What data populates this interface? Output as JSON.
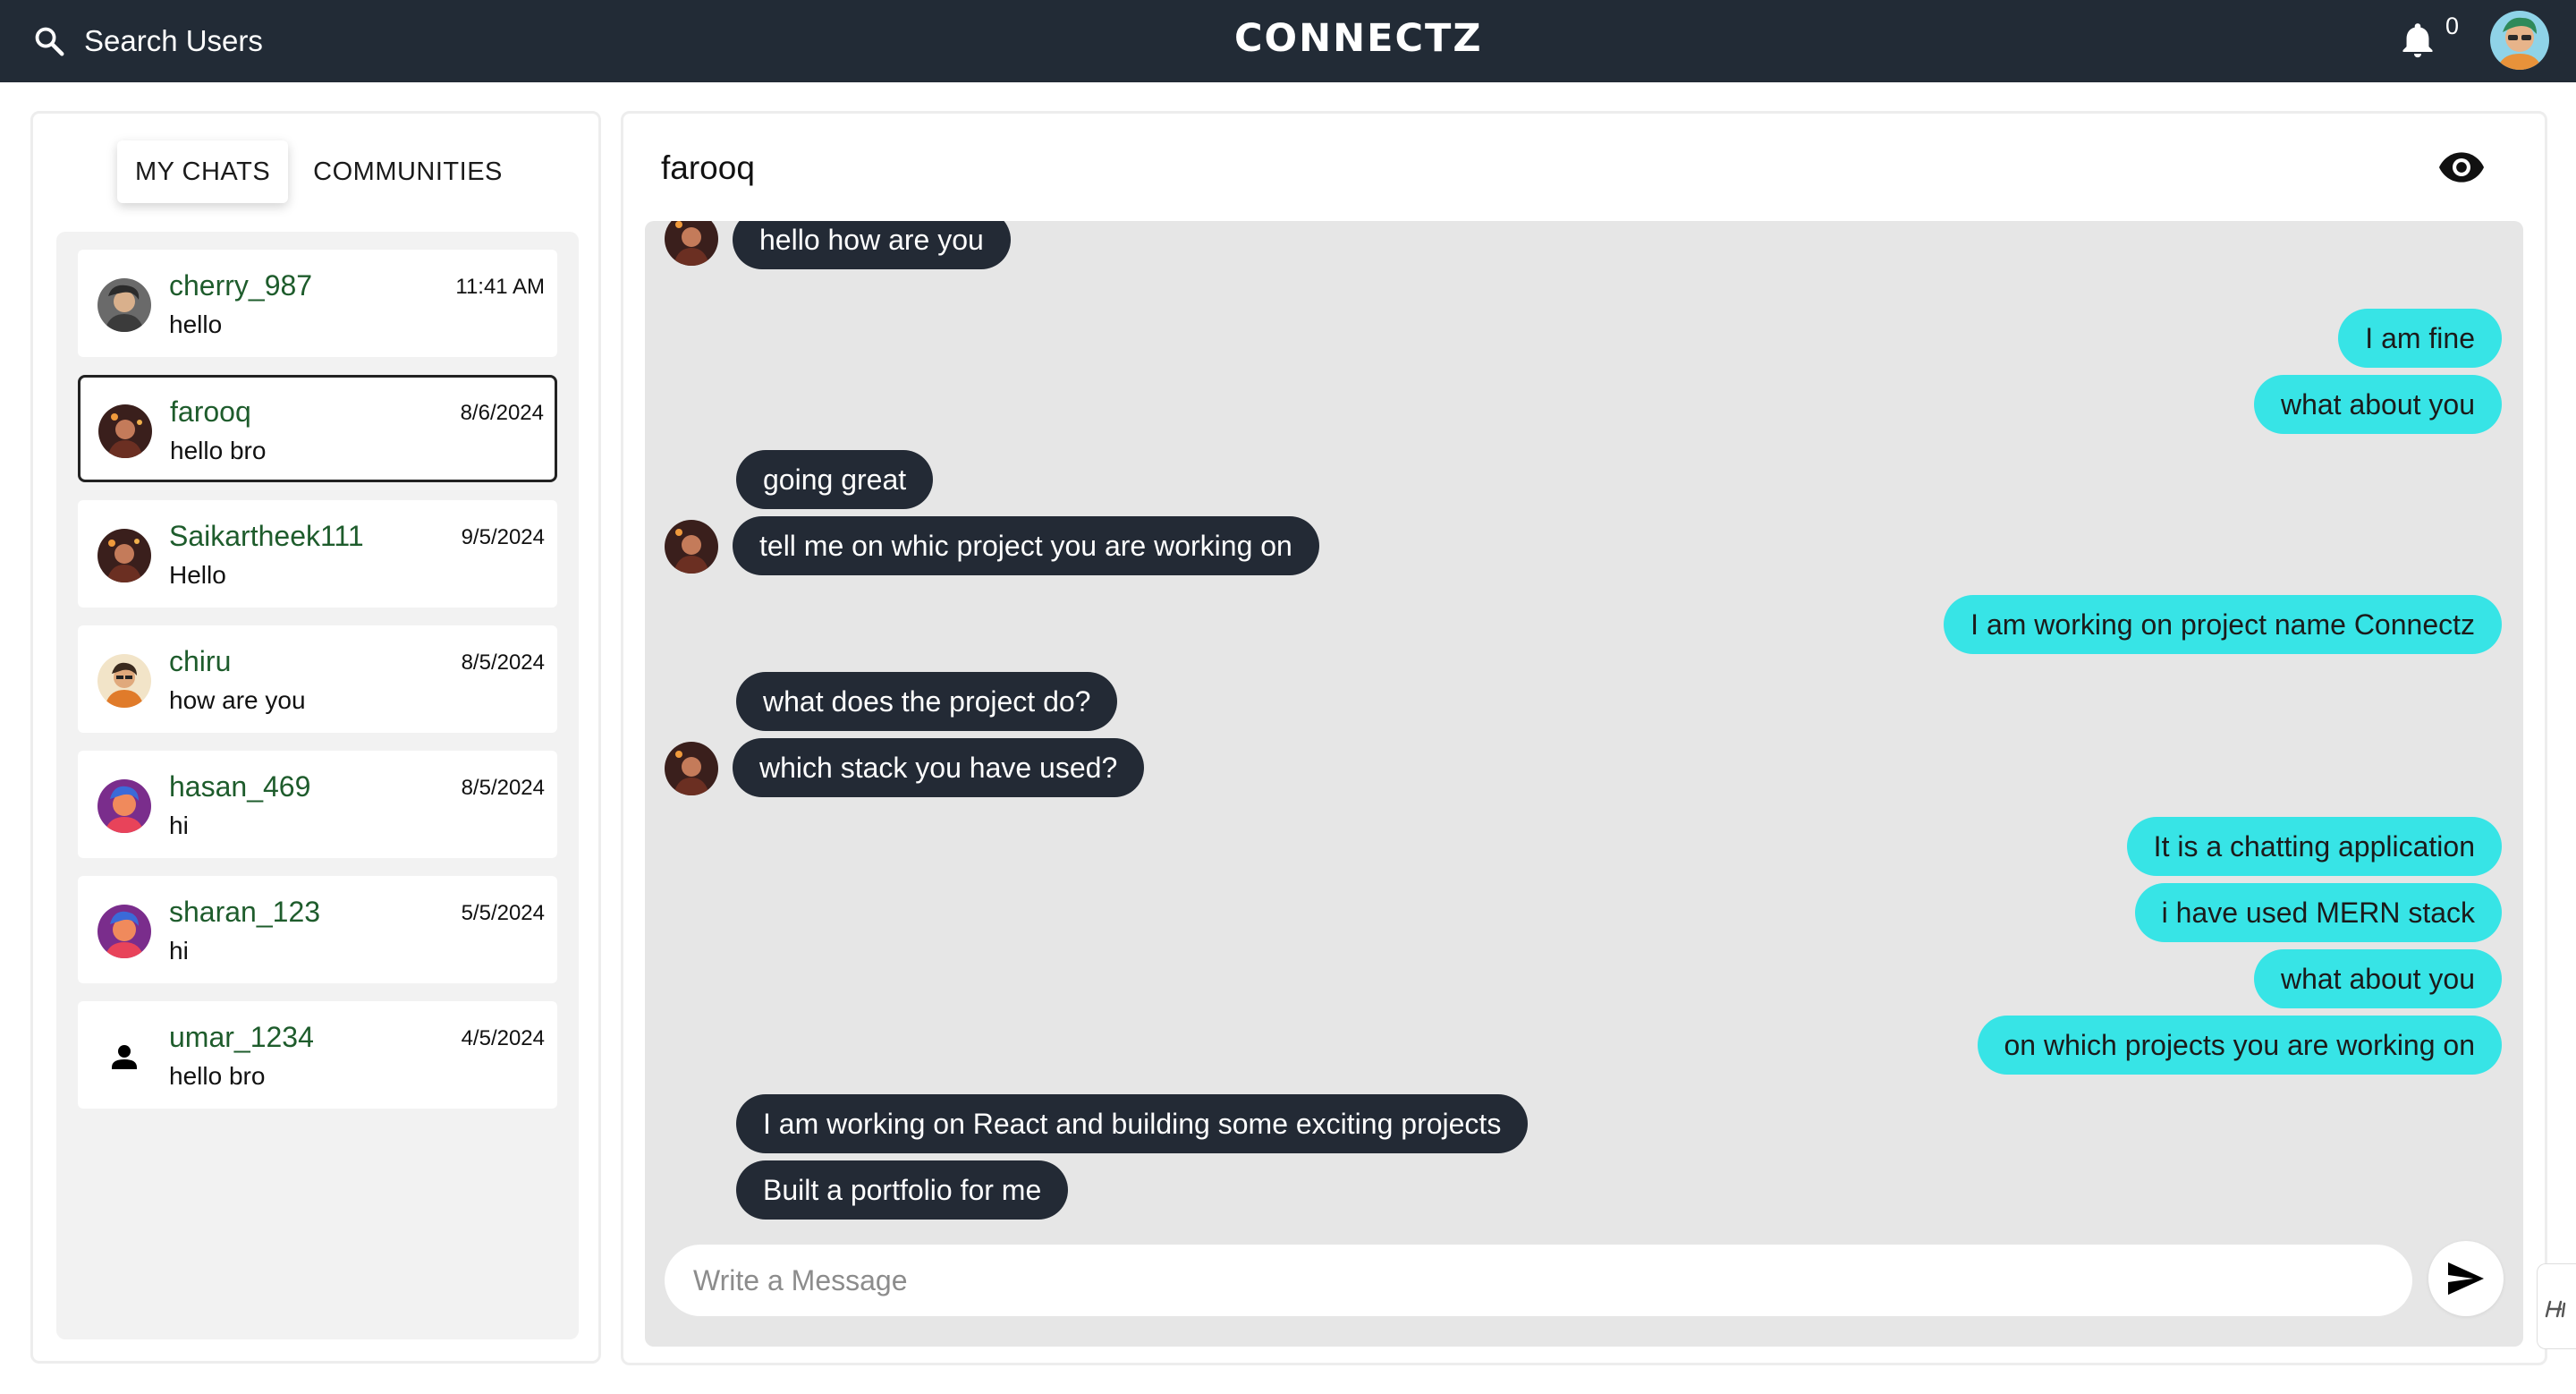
{
  "header": {
    "search_label": "Search Users",
    "brand": "CONNECTZ",
    "notification_count": "0",
    "icons": {
      "search": "search-icon",
      "bell": "bell-icon",
      "profile": "avatar"
    }
  },
  "sidebar": {
    "tabs": [
      {
        "label": "MY CHATS",
        "active": true
      },
      {
        "label": "COMMUNITIES",
        "active": false
      }
    ],
    "chats": [
      {
        "name": "cherry_987",
        "last_message": "hello",
        "time": "11:41 AM",
        "selected": false
      },
      {
        "name": "farooq",
        "last_message": "hello bro",
        "time": "8/6/2024",
        "selected": true
      },
      {
        "name": "Saikartheek111",
        "last_message": "Hello",
        "time": "9/5/2024",
        "selected": false
      },
      {
        "name": "chiru",
        "last_message": "how are you",
        "time": "8/5/2024",
        "selected": false
      },
      {
        "name": "hasan_469",
        "last_message": "hi",
        "time": "8/5/2024",
        "selected": false
      },
      {
        "name": "sharan_123",
        "last_message": "hi",
        "time": "5/5/2024",
        "selected": false
      },
      {
        "name": "umar_1234",
        "last_message": "hello bro",
        "time": "4/5/2024",
        "selected": false
      }
    ]
  },
  "chat": {
    "title": "farooq",
    "messages": [
      {
        "from": "them",
        "text": "hello how are you"
      },
      {
        "from": "me",
        "text": "I am fine"
      },
      {
        "from": "me",
        "text": "what about you"
      },
      {
        "from": "them",
        "text": "going great"
      },
      {
        "from": "them",
        "text": "tell me on whic project you are working on"
      },
      {
        "from": "me",
        "text": "I am working on project name Connectz"
      },
      {
        "from": "them",
        "text": "what does the project do?"
      },
      {
        "from": "them",
        "text": "which stack you have used?"
      },
      {
        "from": "me",
        "text": "It is a chatting application"
      },
      {
        "from": "me",
        "text": "i have used MERN stack"
      },
      {
        "from": "me",
        "text": "what about you"
      },
      {
        "from": "me",
        "text": "on which projects you are working on"
      },
      {
        "from": "them",
        "text": "I am working on React and building some exciting projects"
      },
      {
        "from": "them",
        "text": "Built a portfolio for me"
      }
    ],
    "input_placeholder": "Write a Message",
    "input_value": ""
  },
  "colors": {
    "topbar": "#222b36",
    "incoming_bubble": "#232a35",
    "outgoing_bubble": "#37e4e6",
    "contact_name": "#1e5c2c",
    "conversation_bg": "#e6e6e6"
  }
}
